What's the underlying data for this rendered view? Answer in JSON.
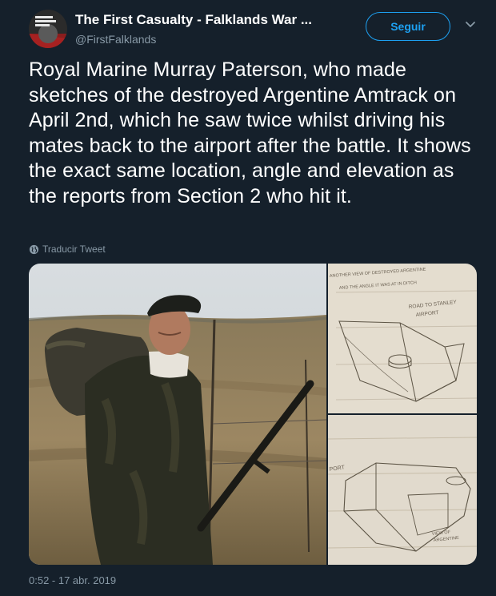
{
  "account": {
    "display_name": "The First Casualty - Falklands War ...",
    "handle": "@FirstFalklands",
    "follow_label": "Seguir"
  },
  "tweet": {
    "text": "Royal Marine Murray Paterson, who made sketches of the destroyed Argentine Amtrack on April 2nd, which he saw twice whilst driving his mates back to the airport after the battle. It shows the exact same location, angle and elevation as the reports from Section 2 who hit it.",
    "translate_label": "Traducir Tweet",
    "timestamp": "0:52 - 17 abr. 2019"
  },
  "sketch_top": {
    "caption_line1": "ANOTHER VIEW OF DESTROYED ARGENTINE",
    "caption_line2": "AND THE ANGLE IT WAS AT IN DITCH",
    "road_label_1": "ROAD TO STANLEY",
    "road_label_2": "AIRPORT"
  },
  "sketch_bottom": {
    "airport_label": "PORT",
    "caption_line1": "VIEW OF",
    "caption_line2": "ARGENTINE"
  },
  "colors": {
    "background": "#15202b",
    "accent": "#1da1f2",
    "muted": "#8899a6"
  },
  "icons": {
    "globe": "globe-icon",
    "caret": "chevron-down-icon"
  }
}
